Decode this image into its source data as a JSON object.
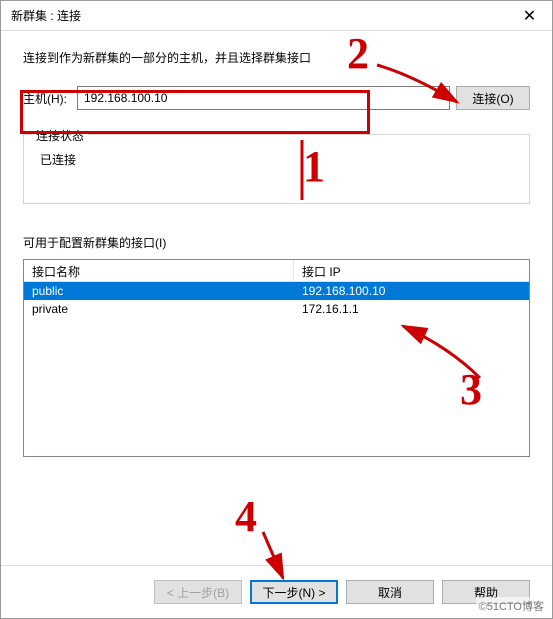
{
  "titlebar": {
    "title": "新群集 : 连接"
  },
  "instruction": "连接到作为新群集的一部分的主机，并且选择群集接口",
  "host": {
    "label": "主机(H):",
    "value": "192.168.100.10",
    "connect_label": "连接(O)"
  },
  "status_group": {
    "legend": "连接状态",
    "status": "已连接"
  },
  "interfaces": {
    "label": "可用于配置新群集的接口(I)",
    "columns": {
      "name": "接口名称",
      "ip": "接口 IP"
    },
    "rows": [
      {
        "name": "public",
        "ip": "192.168.100.10",
        "selected": true
      },
      {
        "name": "private",
        "ip": "172.16.1.1",
        "selected": false
      }
    ]
  },
  "buttons": {
    "back": "< 上一步(B)",
    "next": "下一步(N) >",
    "cancel": "取消",
    "help": "帮助"
  },
  "watermark": "©51CTO博客",
  "annotations": {
    "n1": "1",
    "n2": "2",
    "n3": "3",
    "n4": "4"
  }
}
